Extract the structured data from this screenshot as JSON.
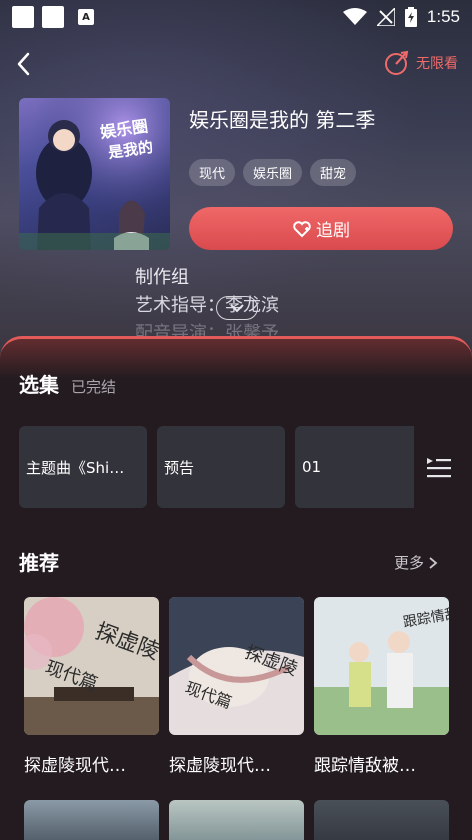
{
  "status_bar": {
    "time": "1:55",
    "notif_label": "A"
  },
  "header": {
    "unlimited_label": "无限看"
  },
  "drama": {
    "title": "娱乐圈是我的 第二季",
    "tags": [
      "现代",
      "娱乐圈",
      "甜宠"
    ],
    "follow_label": "追剧",
    "cover_text": "娱乐圈是我的",
    "staff_heading": "制作组",
    "staff_art": "艺术指导：李龙滨",
    "staff_voice": "配音导演：张馨予"
  },
  "episodes": {
    "title": "选集",
    "status": "已完结",
    "items": [
      "主题曲《Shi…",
      "预告",
      "01"
    ]
  },
  "recommend": {
    "title": "推荐",
    "more_label": "更多",
    "items": [
      {
        "title": "探虚陵现代…",
        "cover_text": "探虚陵"
      },
      {
        "title": "探虚陵现代…",
        "cover_text": "探虚陵"
      },
      {
        "title": "跟踪情敌被…",
        "cover_text": "跟踪情敌"
      }
    ]
  },
  "colors": {
    "accent": "#e35a5a",
    "sheet_bg": "#231b20",
    "card_bg": "#33343b"
  },
  "icons": [
    "back-icon",
    "unlimited-icon",
    "heart-plus-icon",
    "chevron-down-icon",
    "episode-list-icon",
    "chevron-right-icon",
    "wifi-icon",
    "battery-icon",
    "signal-icon"
  ]
}
